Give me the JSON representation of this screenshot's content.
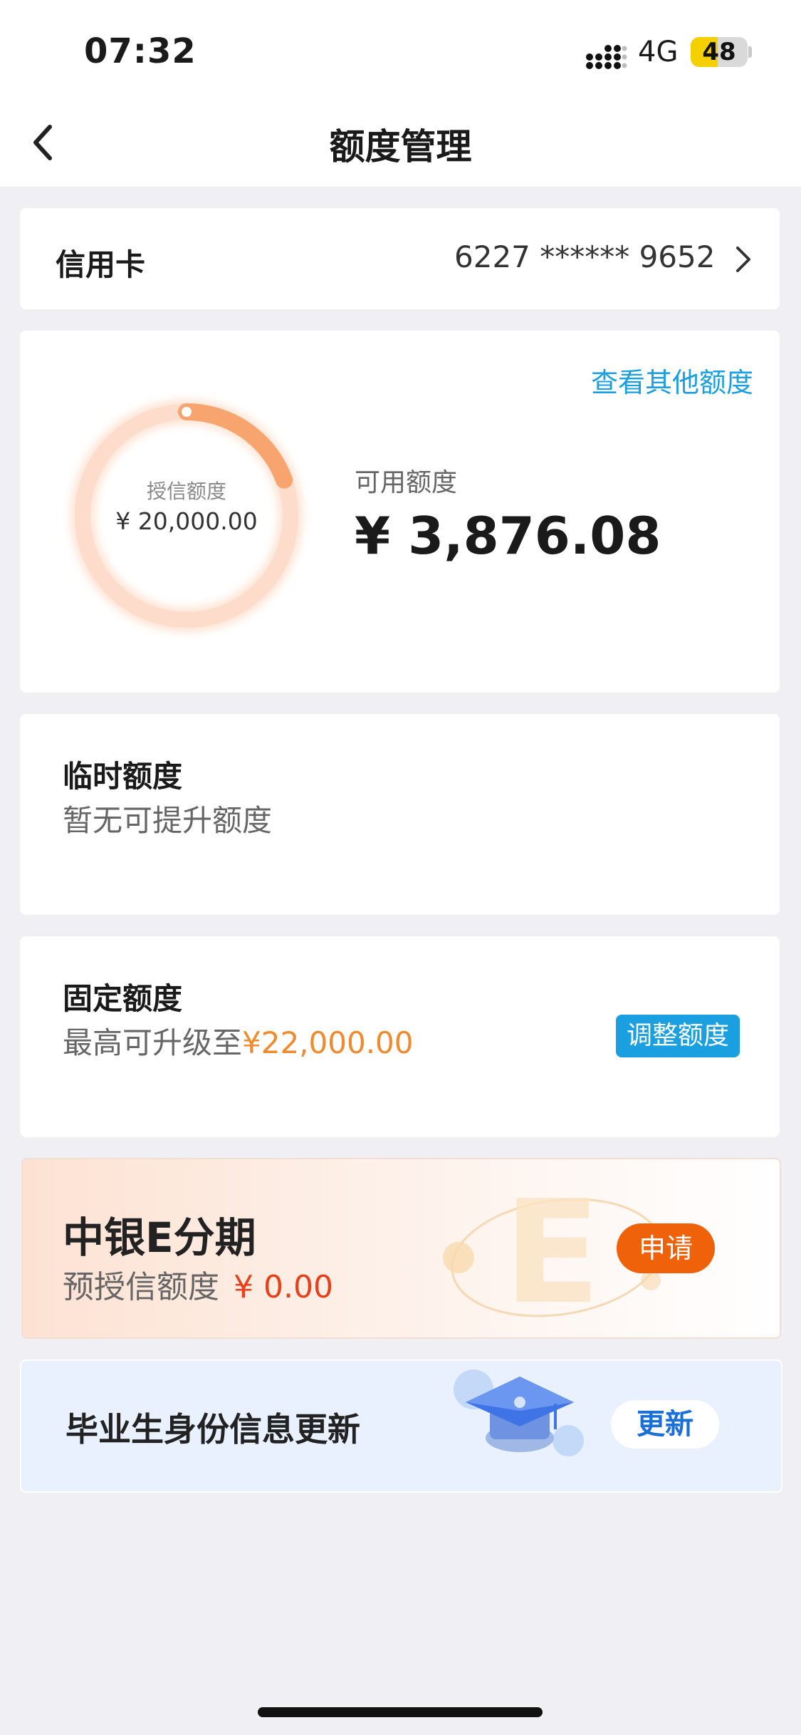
{
  "status_bar": {
    "time": "07:32",
    "network": "4G",
    "battery": "48",
    "battery_level": 0.48
  },
  "nav": {
    "title": "额度管理"
  },
  "card_row": {
    "label": "信用卡",
    "number": "6227 ****** 9652"
  },
  "credit": {
    "other_link": "查看其他额度",
    "ring_label": "授信额度",
    "ring_value": "¥ 20,000.00",
    "available_label": "可用额度",
    "available_value": "¥ 3,876.08",
    "available_ratio": 0.194
  },
  "temp_limit": {
    "title": "临时额度",
    "desc": "暂无可提升额度"
  },
  "fixed_limit": {
    "title": "固定额度",
    "desc_prefix": "最高可升级至",
    "desc_amount": "¥22,000.00",
    "button": "调整额度"
  },
  "installment": {
    "title": "中银E分期",
    "desc_prefix": "预授信额度",
    "desc_amount": "¥ 0.00",
    "button": "申请"
  },
  "graduate": {
    "title": "毕业生身份信息更新",
    "button": "更新"
  },
  "colors": {
    "accent_blue": "#1a9fe0",
    "accent_orange": "#f0620a",
    "amount_orange": "#f08a2c",
    "ring": "#f7a46e"
  }
}
